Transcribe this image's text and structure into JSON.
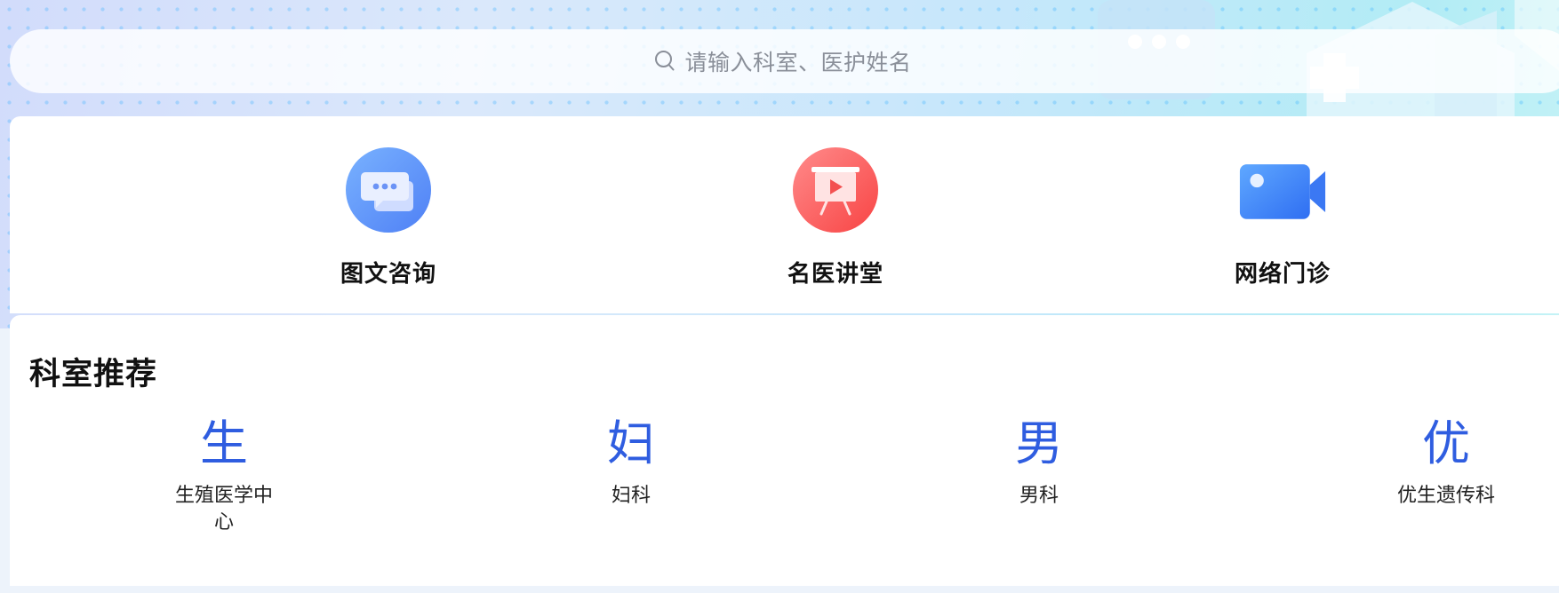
{
  "search": {
    "placeholder": "请输入科室、医护姓名",
    "icon": "search-icon"
  },
  "services": [
    {
      "label": "图文咨询",
      "icon": "chat-bubbles-icon",
      "color": "#5b8cf8"
    },
    {
      "label": "名医讲堂",
      "icon": "presentation-board-icon",
      "color": "#fa4f4f"
    },
    {
      "label": "网络门诊",
      "icon": "video-camera-icon",
      "color": "#3b7df6"
    }
  ],
  "departments": {
    "title": "科室推荐",
    "accent_color": "#2f5de0",
    "items": [
      {
        "glyph": "生",
        "name": "生殖医学中心"
      },
      {
        "glyph": "妇",
        "name": "妇科"
      },
      {
        "glyph": "男",
        "name": "男科"
      },
      {
        "glyph": "优",
        "name": "优生遗传科"
      }
    ]
  }
}
